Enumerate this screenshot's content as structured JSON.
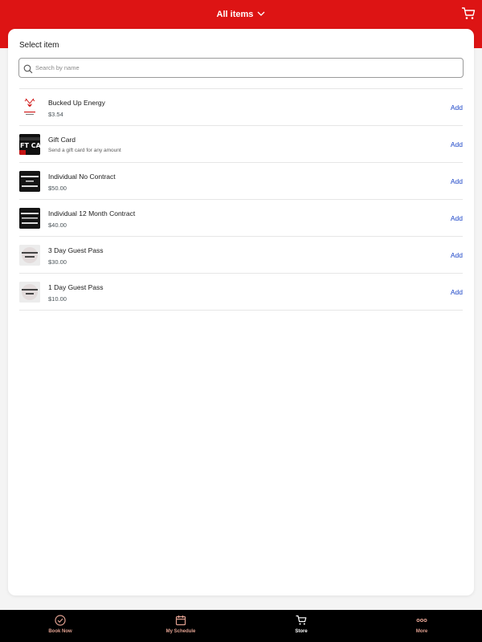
{
  "header": {
    "title": "All items",
    "title_icon": "chevron-down-icon",
    "cart_icon": "cart-icon",
    "background_color": "#dd1414"
  },
  "panel": {
    "title": "Select item"
  },
  "search": {
    "placeholder": "Search by name",
    "value": "",
    "icon": "search-icon"
  },
  "items": [
    {
      "name": "Bucked Up Energy",
      "price": "$3.54",
      "subtitle": "",
      "action": "Add",
      "thumb": "bucked-up-logo"
    },
    {
      "name": "Gift Card",
      "price": "",
      "subtitle": "Send a gift card for any amount",
      "action": "Add",
      "thumb": "gift-card-image"
    },
    {
      "name": "Individual No Contract",
      "price": "$50.00",
      "subtitle": "",
      "action": "Add",
      "thumb": "no-contract-image"
    },
    {
      "name": "Individual 12 Month Contract",
      "price": "$40.00",
      "subtitle": "",
      "action": "Add",
      "thumb": "12-month-contract-image"
    },
    {
      "name": "3 Day Guest Pass",
      "price": "$30.00",
      "subtitle": "",
      "action": "Add",
      "thumb": "3-day-pass-image"
    },
    {
      "name": "1 Day Guest Pass",
      "price": "$10.00",
      "subtitle": "",
      "action": "Add",
      "thumb": "1-day-pass-image"
    }
  ],
  "bottom_nav": [
    {
      "label": "Book Now",
      "icon": "check-circle-icon",
      "active": false
    },
    {
      "label": "My Schedule",
      "icon": "calendar-icon",
      "active": false
    },
    {
      "label": "Store",
      "icon": "cart-icon",
      "active": true
    },
    {
      "label": "More",
      "icon": "more-dots-icon",
      "active": false
    }
  ],
  "colors": {
    "accent_red": "#dd1414",
    "link_blue": "#1e47c8",
    "nav_inactive": "#e0a090",
    "nav_active": "#ffffff"
  }
}
